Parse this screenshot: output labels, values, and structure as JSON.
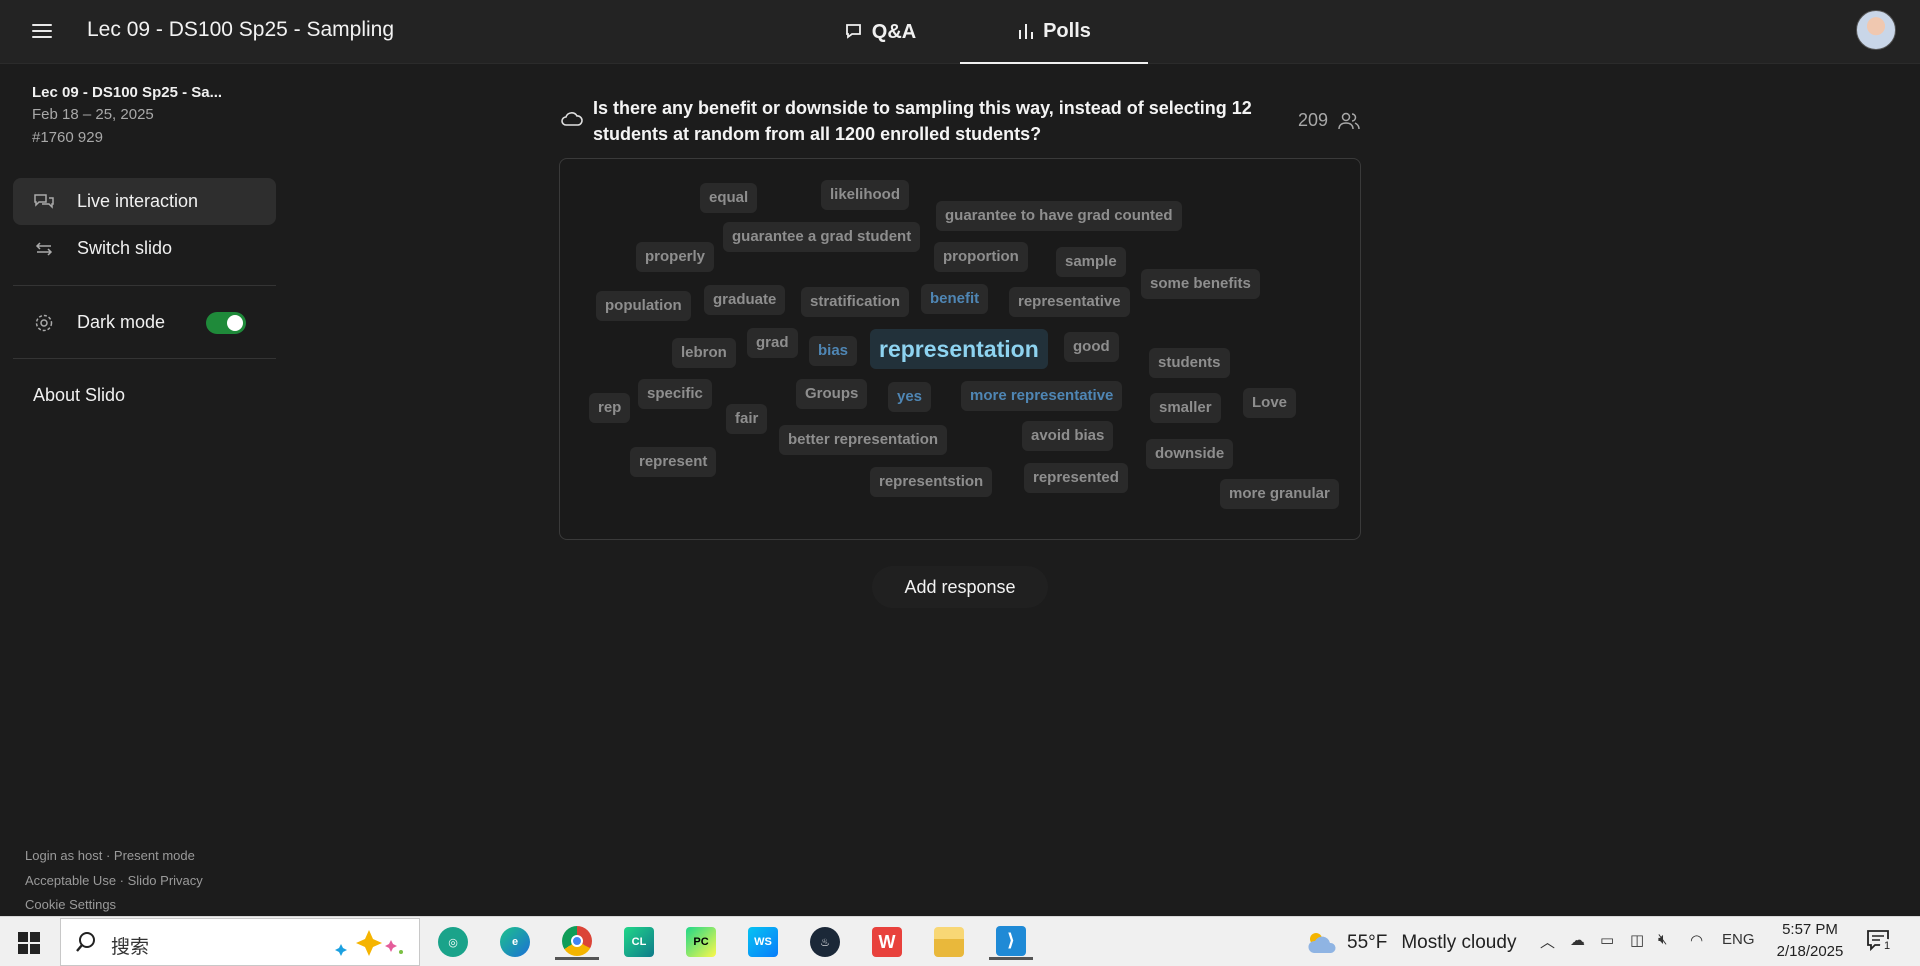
{
  "header": {
    "title": "Lec 09 - DS100 Sp25 - Sampling",
    "tabs": [
      {
        "label": "Q&A",
        "icon": "chat-bubble-icon"
      },
      {
        "label": "Polls",
        "icon": "bar-chart-icon",
        "active": true
      }
    ]
  },
  "sidebar": {
    "event_name": "Lec 09 - DS100 Sp25 - Sa...",
    "event_dates": "Feb 18 – 25, 2025",
    "event_code": "#1760 929",
    "nav": [
      {
        "label": "Live interaction",
        "icon": "chat-bubbles-icon",
        "active": true
      },
      {
        "label": "Switch slido",
        "icon": "swap-arrows-icon"
      }
    ],
    "dark_mode_label": "Dark mode",
    "dark_mode_on": true,
    "about_label": "About Slido",
    "footer": {
      "login_host": "Login as host",
      "present_mode": "Present mode",
      "acceptable_use": "Acceptable Use",
      "privacy": "Slido Privacy",
      "cookie_settings": "Cookie Settings"
    }
  },
  "poll": {
    "question": "Is there any benefit or downside to sampling this way, instead of selecting 12 students at random from all 1200 enrolled students?",
    "participants": "209",
    "words": [
      "equal",
      "likelihood",
      "guarantee to have grad counted",
      "guarantee a grad student",
      "properly",
      "proportion",
      "sample",
      "population",
      "graduate",
      "stratification",
      "benefit",
      "representative",
      "some benefits",
      "lebron",
      "grad",
      "bias",
      "representation",
      "good",
      "students",
      "rep",
      "specific",
      "Groups",
      "yes",
      "more representative",
      "smaller",
      "Love",
      "fair",
      "better representation",
      "avoid bias",
      "downside",
      "represent",
      "representstion",
      "represented",
      "more granular"
    ],
    "add_response_label": "Add response"
  },
  "taskbar": {
    "search_placeholder": "搜索",
    "apps": [
      {
        "name": "copilot-icon"
      },
      {
        "name": "chatgpt-icon"
      },
      {
        "name": "edge-icon"
      },
      {
        "name": "chrome-icon",
        "active": true
      },
      {
        "name": "clion-icon",
        "label": "CL"
      },
      {
        "name": "pycharm-icon",
        "label": "PC"
      },
      {
        "name": "webstorm-icon",
        "label": "WS"
      },
      {
        "name": "steam-icon"
      },
      {
        "name": "wps-icon"
      },
      {
        "name": "file-explorer-icon"
      },
      {
        "name": "vscode-icon",
        "active": true
      }
    ],
    "weather_temp": "55°F",
    "weather_desc": "Mostly cloudy",
    "language": "ENG",
    "time": "5:57 PM",
    "date": "2/18/2025",
    "notification_count": "1"
  }
}
